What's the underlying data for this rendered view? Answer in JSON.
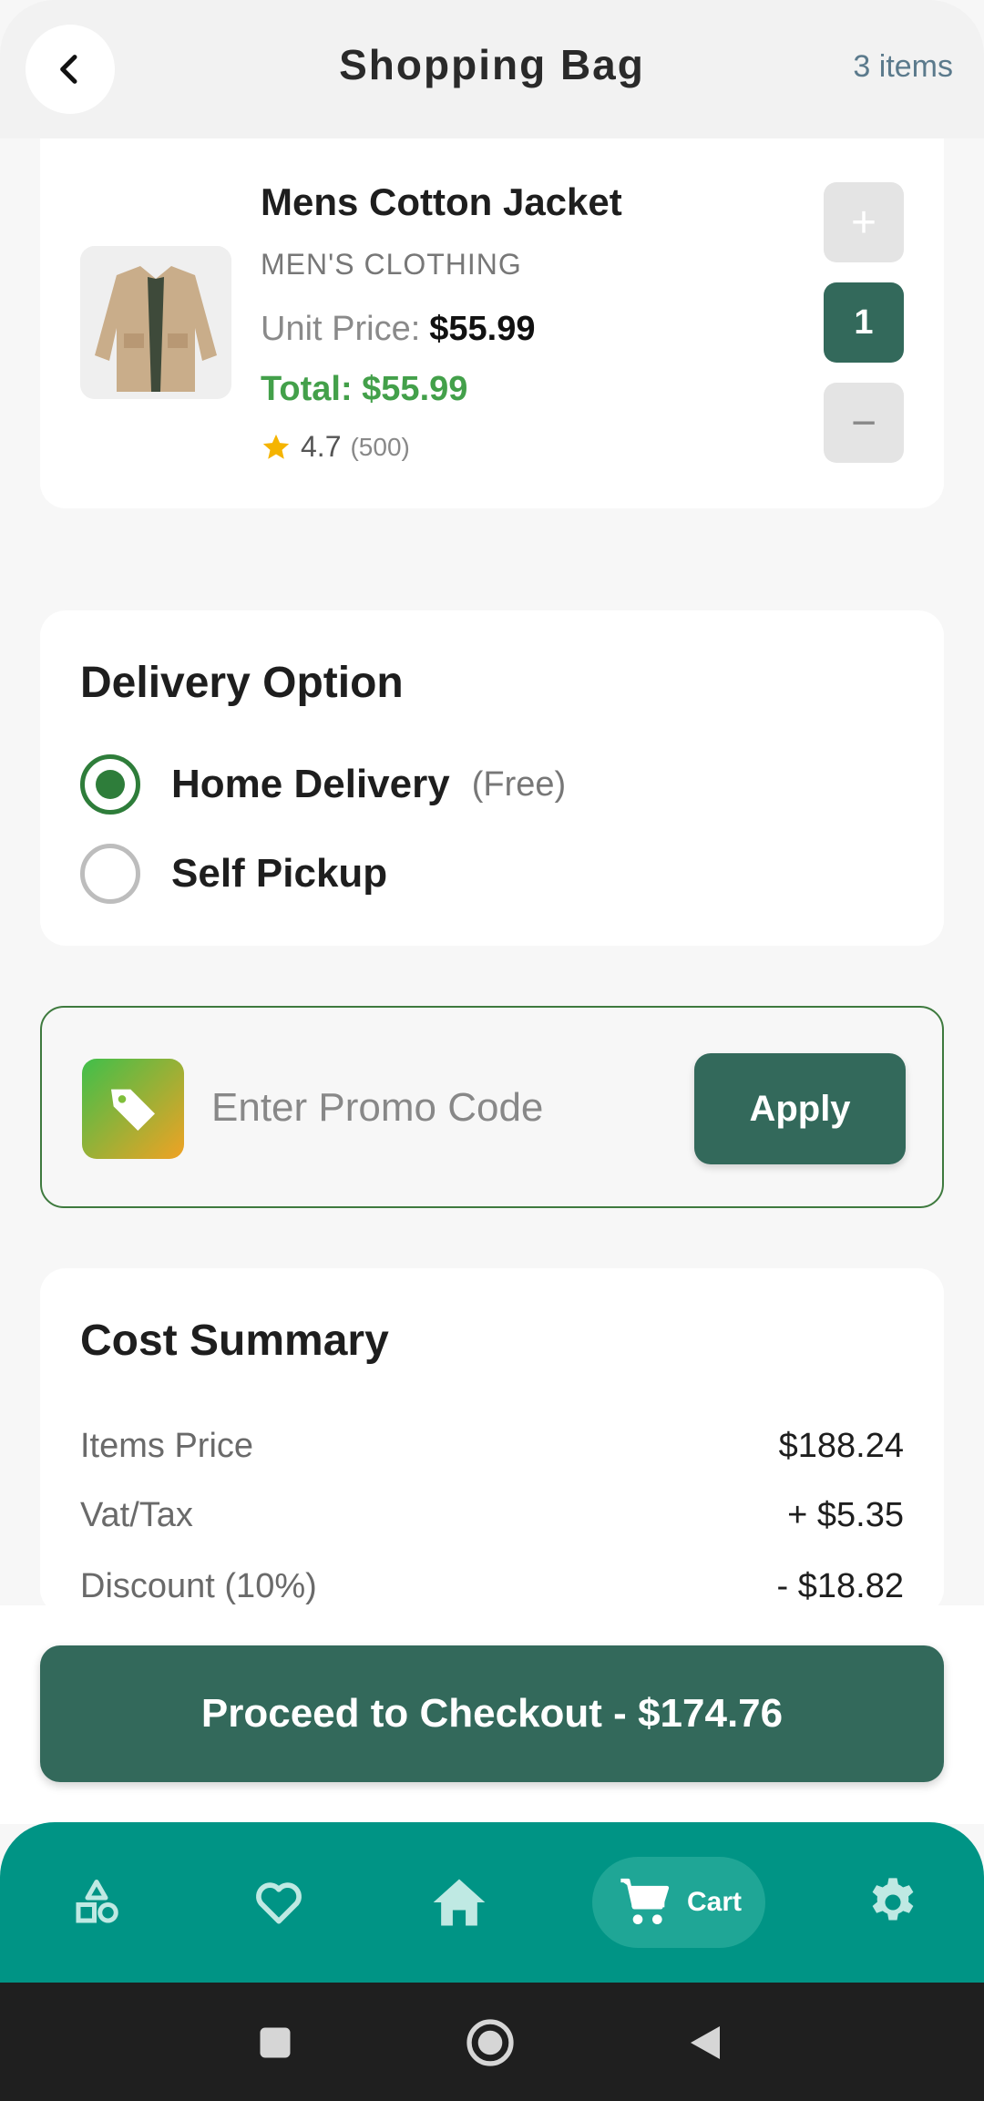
{
  "header": {
    "title": "Shopping Bag",
    "item_count": "3 items"
  },
  "product": {
    "name": "Mens Cotton Jacket",
    "category": "MEN'S CLOTHING",
    "unit_price_label": "Unit Price:",
    "unit_price": "$55.99",
    "total": "Total: $55.99",
    "rating": "4.7",
    "rating_count": "(500)",
    "quantity": "1",
    "plus": "+",
    "minus": "−"
  },
  "delivery": {
    "title": "Delivery Option",
    "options": [
      {
        "label": "Home Delivery",
        "note": "(Free)",
        "selected": true
      },
      {
        "label": "Self Pickup",
        "note": "",
        "selected": false
      }
    ]
  },
  "promo": {
    "placeholder": "Enter Promo Code",
    "apply_label": "Apply"
  },
  "cost_summary": {
    "title": "Cost Summary",
    "rows": [
      {
        "label": "Items Price",
        "value": "$188.24"
      },
      {
        "label": "Vat/Tax",
        "value": "+ $5.35"
      },
      {
        "label": "Discount (10%)",
        "value": "- $18.82"
      }
    ]
  },
  "checkout": {
    "label": "Proceed to Checkout - $174.76"
  },
  "nav": {
    "items": [
      "categories-icon",
      "heart-icon",
      "home-icon",
      "cart-icon",
      "gear-icon"
    ],
    "active_label": "Cart"
  },
  "colors": {
    "primary": "#33695b",
    "nav": "#009485",
    "price_green": "#43a04a"
  }
}
